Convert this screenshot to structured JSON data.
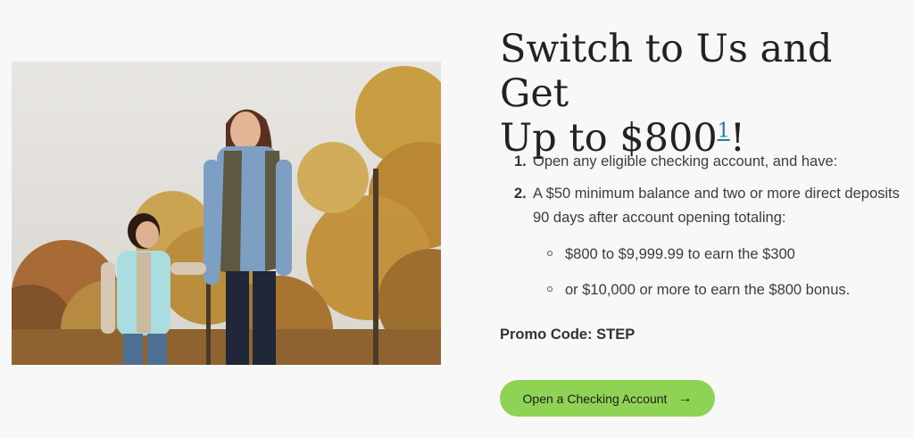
{
  "headline": {
    "line1": "Switch to Us and Get",
    "line2": "Up to $800",
    "footnote": "1",
    "suffix": "!"
  },
  "steps": [
    {
      "number": "1.",
      "text": "Open any eligible checking account, and have:"
    },
    {
      "number": "2.",
      "text": "A $50 minimum balance and two or more direct deposits 90 days after account opening totaling:"
    }
  ],
  "sub_items": [
    {
      "text": "$800 to $9,999.99 to earn the $300"
    },
    {
      "text": "or $10,000 or more to earn the $800 bonus."
    }
  ],
  "promo": "Promo Code: STEP",
  "cta": {
    "label": "Open a Checking Account",
    "icon": "arrow-right-icon"
  },
  "colors": {
    "accent": "#8fd355",
    "link": "#1a7ba8"
  }
}
